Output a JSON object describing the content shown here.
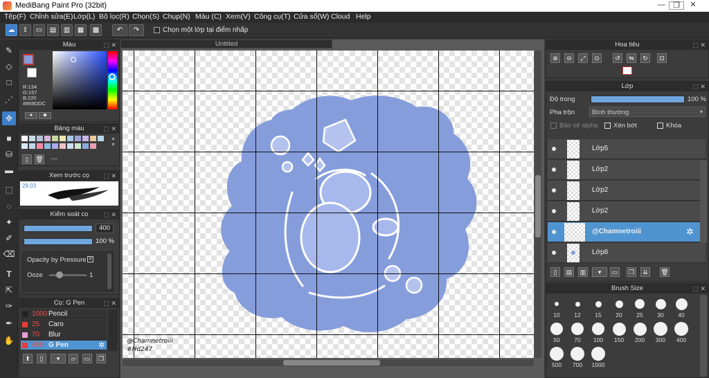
{
  "app": {
    "title": "MediBang Paint Pro (32bit)"
  },
  "window_controls": {
    "minimize": "—",
    "maximize": "❐",
    "close": "✕"
  },
  "menu": [
    "Tệp(F)",
    "Chỉnh sửa(E)",
    "Lớp(L)",
    "Bộ lọc(R)",
    "Chọn(S)",
    "Chụp(N)",
    "Màu (C)",
    "Xem(V)",
    "Công cụ(T)",
    "Cửa sổ(W)",
    "Cloud",
    "Help"
  ],
  "toolbar": {
    "select_layer_option": "Chọn một lớp tại điểm nhấp"
  },
  "color_panel": {
    "title": "Màu",
    "r": "R:134",
    "g": "G:157",
    "b": "B:220",
    "hex": "#869DDC",
    "primary": "#869DDC"
  },
  "palette_panel": {
    "title": "Bảng màu",
    "dashes": "---",
    "swatches": [
      "#ffffff",
      "#c8dbe8",
      "#b4c0d8",
      "#d8b4d8",
      "#c8d8a0",
      "#e8e8b0",
      "#a8c8e8",
      "#a0a0d8",
      "#c8b4e8",
      "#e8c8a0",
      "#b8d8f0",
      "#d8e8f8",
      "#c4d4ec",
      "#ff88aa",
      "#8cbce4",
      "#aaaaee",
      "#f0c0c8",
      "#cfe0f0",
      "#d0e8d0",
      "#8caadd",
      "#e8a0b0"
    ]
  },
  "brush_preview": {
    "title": "Xem trước cọ",
    "size": "29.03"
  },
  "brush_control": {
    "title": "Kiểm soát cọ",
    "size": "400",
    "opacity": "100 %",
    "opacity_pressure": "Opacity by Pressure",
    "ooze": "Ooze",
    "ooze_value": "1"
  },
  "brush_list": {
    "title": "Cọ: G Pen",
    "items": [
      {
        "size": "1000",
        "name": "Pencil",
        "color": "#222222"
      },
      {
        "size": "25",
        "name": "Caro",
        "color": "#e83a3a"
      },
      {
        "size": "70",
        "name": "Blur",
        "color": "#e8a0d8"
      },
      {
        "size": "400",
        "name": "G Pen",
        "color": "#e83a3a"
      }
    ]
  },
  "canvas": {
    "tab": "Untitled",
    "signature_line1": "@Chamnetroiii",
    "signature_line2": "#Hd247",
    "fill_color": "#869DDC"
  },
  "navigator": {
    "title": "Hoa tiêu"
  },
  "layers_panel": {
    "title": "Lớp",
    "opacity_label": "Độ trong",
    "opacity_value": "100 %",
    "blend_label": "Pha trộn",
    "blend_value": "Bình thường",
    "opt_alpha": "Bảo vệ alpha",
    "opt_clip": "Xén bớt",
    "opt_lock": "Khóa",
    "layers": [
      {
        "name": "Lớp5",
        "selected": false
      },
      {
        "name": "Lớp2",
        "selected": false
      },
      {
        "name": "Lớp2",
        "selected": false
      },
      {
        "name": "Lớp2",
        "selected": false
      },
      {
        "name": "@Chamnetroiii",
        "selected": true
      },
      {
        "name": "Lớp8",
        "selected": false
      }
    ]
  },
  "brush_size_panel": {
    "title": "Brush Size",
    "sizes": [
      "10",
      "12",
      "15",
      "20",
      "25",
      "30",
      "40",
      "50",
      "70",
      "100",
      "150",
      "200",
      "300",
      "400",
      "500",
      "700",
      "1000"
    ]
  }
}
